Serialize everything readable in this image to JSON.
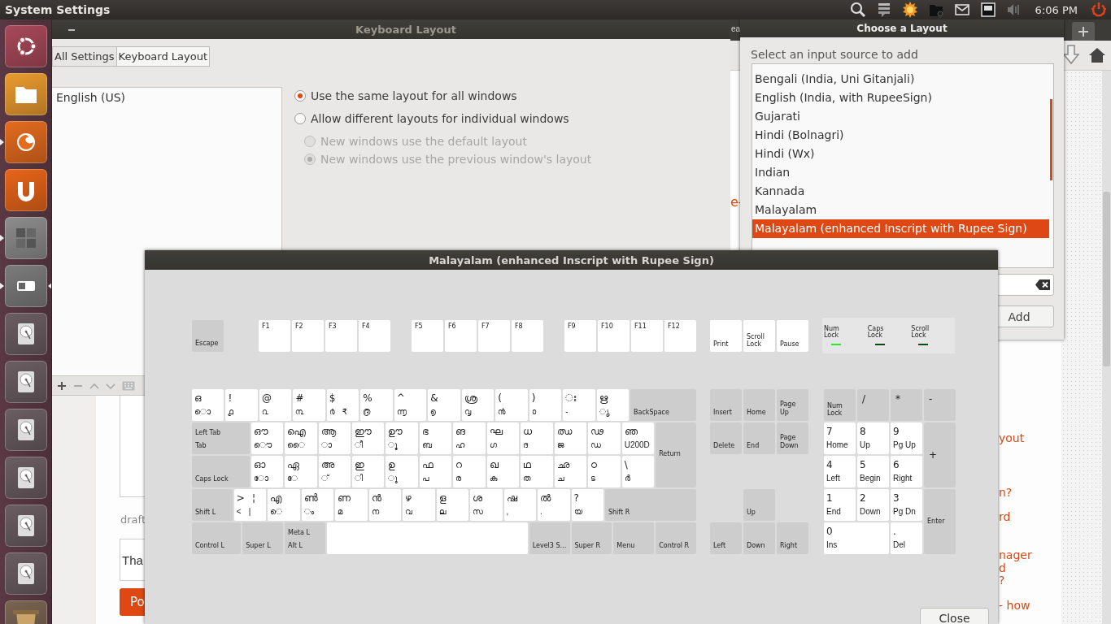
{
  "top_panel": {
    "title": "System Settings",
    "clock": "6:06 PM"
  },
  "launcher": {
    "items": [
      {
        "kind": "dash",
        "running": false,
        "focused": false
      },
      {
        "kind": "files",
        "running": false,
        "focused": false
      },
      {
        "kind": "browser",
        "running": true,
        "focused": false
      },
      {
        "kind": "u_one",
        "running": false,
        "focused": false
      },
      {
        "kind": "workspaces",
        "running": true,
        "focused": false
      },
      {
        "kind": "settings",
        "running": true,
        "focused": true
      },
      {
        "kind": "disk",
        "running": false,
        "focused": false
      },
      {
        "kind": "disk",
        "running": false,
        "focused": false
      },
      {
        "kind": "disk",
        "running": false,
        "focused": false
      },
      {
        "kind": "disk",
        "running": false,
        "focused": false
      },
      {
        "kind": "disk",
        "running": false,
        "focused": false
      },
      {
        "kind": "disk",
        "running": false,
        "focused": false
      },
      {
        "kind": "trash",
        "running": false,
        "focused": false
      }
    ]
  },
  "browser": {
    "tab_fragment": "ea",
    "heading_fragment": "e-",
    "caption": "draft",
    "reply_value": "Tha",
    "post_button": "Po",
    "sidebar_links": [
      "yout",
      "n?",
      "rd",
      "nager",
      "d",
      "?",
      "- how"
    ]
  },
  "keyboard_layout_window": {
    "title": "Keyboard Layout",
    "breadcrumbs": [
      {
        "label": "All Settings",
        "selected": false
      },
      {
        "label": "Keyboard Layout",
        "selected": true
      }
    ],
    "input_sources": [
      {
        "label": "English (US)",
        "selected": false
      }
    ],
    "layout_mode": [
      {
        "label": "Use the same layout for all windows",
        "selected": true,
        "disabled": false
      },
      {
        "label": "Allow different layouts for individual windows",
        "selected": false,
        "disabled": false
      }
    ],
    "new_window_mode": [
      {
        "label": "New windows use the default layout",
        "selected": false,
        "disabled": true
      },
      {
        "label": "New windows use the previous window's layout",
        "selected": true,
        "disabled": true
      }
    ]
  },
  "choose_layout_dialog": {
    "title": "Choose a Layout",
    "prompt": "Select an input source to add",
    "layouts": [
      {
        "label": "Bengali (India, Uni Gitanjali)",
        "selected": false
      },
      {
        "label": "English (India, with RupeeSign)",
        "selected": false
      },
      {
        "label": "Gujarati",
        "selected": false
      },
      {
        "label": "Hindi (Bolnagri)",
        "selected": false
      },
      {
        "label": "Hindi (Wx)",
        "selected": false
      },
      {
        "label": "Indian",
        "selected": false
      },
      {
        "label": "Kannada",
        "selected": false
      },
      {
        "label": "Malayalam",
        "selected": false
      },
      {
        "label": "Malayalam (enhanced Inscript with Rupee Sign)",
        "selected": true
      }
    ],
    "add_button": "Add"
  },
  "keyboard_window": {
    "title": "Malayalam (enhanced Inscript with Rupee Sign)",
    "function_groups": [
      [
        {
          "kind": "func",
          "lines": [
            [
              "Escape"
            ]
          ]
        }
      ],
      [
        {
          "kind": "fkey",
          "lines": [
            [
              "F1"
            ]
          ]
        },
        {
          "kind": "fkey",
          "lines": [
            [
              "F2"
            ]
          ]
        },
        {
          "kind": "fkey",
          "lines": [
            [
              "F3"
            ]
          ]
        },
        {
          "kind": "fkey",
          "lines": [
            [
              "F4"
            ]
          ]
        }
      ],
      [
        {
          "kind": "fkey",
          "lines": [
            [
              "F5"
            ]
          ]
        },
        {
          "kind": "fkey",
          "lines": [
            [
              "F6"
            ]
          ]
        },
        {
          "kind": "fkey",
          "lines": [
            [
              "F7"
            ]
          ]
        },
        {
          "kind": "fkey",
          "lines": [
            [
              "F8"
            ]
          ]
        }
      ],
      [
        {
          "kind": "fkey",
          "lines": [
            [
              "F9"
            ]
          ]
        },
        {
          "kind": "fkey",
          "lines": [
            [
              "F10"
            ]
          ]
        },
        {
          "kind": "fkey",
          "lines": [
            [
              "F11"
            ]
          ]
        },
        {
          "kind": "fkey",
          "lines": [
            [
              "F12"
            ]
          ]
        }
      ]
    ],
    "system_keys": [
      {
        "kind": "sys",
        "lines": [
          [
            "Print"
          ]
        ]
      },
      {
        "kind": "sys",
        "lines": [
          [
            "Scroll Lock"
          ]
        ]
      },
      {
        "kind": "sys",
        "lines": [
          [
            "Pause"
          ]
        ]
      }
    ],
    "indicators": [
      {
        "label": "Num Lock",
        "on": true
      },
      {
        "label": "Caps Lock",
        "on": false
      },
      {
        "label": "Scroll Lock",
        "on": false
      }
    ],
    "main_rows": [
      [
        {
          "kind": "char",
          "lines": [
            [
              "ഒ"
            ],
            [
              "ൊ"
            ]
          ]
        },
        {
          "kind": "char",
          "lines": [
            [
              "!"
            ],
            [
              "൧"
            ]
          ]
        },
        {
          "kind": "char",
          "lines": [
            [
              "@"
            ],
            [
              "൨"
            ]
          ]
        },
        {
          "kind": "char",
          "lines": [
            [
              "#"
            ],
            [
              "൩"
            ]
          ]
        },
        {
          "kind": "char",
          "lines": [
            [
              "$"
            ],
            [
              "൪",
              "₹"
            ]
          ]
        },
        {
          "kind": "char",
          "lines": [
            [
              "%"
            ],
            [
              "൫"
            ]
          ]
        },
        {
          "kind": "char",
          "lines": [
            [
              "^"
            ],
            [
              "൬"
            ]
          ]
        },
        {
          "kind": "char",
          "lines": [
            [
              "&"
            ],
            [
              "൭"
            ]
          ]
        },
        {
          "kind": "char",
          "lines": [
            [
              "ശ്ര"
            ],
            [
              "൮"
            ]
          ]
        },
        {
          "kind": "char",
          "lines": [
            [
              "("
            ],
            [
              "൯"
            ]
          ]
        },
        {
          "kind": "char",
          "lines": [
            [
              ")"
            ],
            [
              "൦"
            ]
          ]
        },
        {
          "kind": "char",
          "lines": [
            [
              "ഃ"
            ],
            [
              "-"
            ]
          ]
        },
        {
          "kind": "char",
          "lines": [
            [
              "ഋ"
            ],
            [
              "ൃ"
            ]
          ]
        },
        {
          "kind": "func",
          "lines": [
            [
              "BackSpace"
            ]
          ]
        }
      ],
      [
        {
          "kind": "func",
          "lines": [
            [
              "Left Tab"
            ],
            [
              "Tab"
            ]
          ]
        },
        {
          "kind": "char",
          "lines": [
            [
              "ഔ"
            ],
            [
              "ൌ"
            ]
          ]
        },
        {
          "kind": "char",
          "lines": [
            [
              "ഐ"
            ],
            [
              "ൈ"
            ]
          ]
        },
        {
          "kind": "char",
          "lines": [
            [
              "ആ"
            ],
            [
              "ാ"
            ]
          ]
        },
        {
          "kind": "char",
          "lines": [
            [
              "ഈ"
            ],
            [
              "ീ"
            ]
          ]
        },
        {
          "kind": "char",
          "lines": [
            [
              "ഊ"
            ],
            [
              "ൂ"
            ]
          ]
        },
        {
          "kind": "char",
          "lines": [
            [
              "ഭ"
            ],
            [
              "ബ"
            ]
          ]
        },
        {
          "kind": "char",
          "lines": [
            [
              "ങ"
            ],
            [
              "ഹ"
            ]
          ]
        },
        {
          "kind": "char",
          "lines": [
            [
              "ഘ"
            ],
            [
              "ഗ"
            ]
          ]
        },
        {
          "kind": "char",
          "lines": [
            [
              "ധ"
            ],
            [
              "ദ"
            ]
          ]
        },
        {
          "kind": "char",
          "lines": [
            [
              "ഝ"
            ],
            [
              "ജ"
            ]
          ]
        },
        {
          "kind": "char",
          "lines": [
            [
              "ഢ"
            ],
            [
              "ഡ"
            ]
          ]
        },
        {
          "kind": "char",
          "lines": [
            [
              "ഞ"
            ],
            [
              "U200D"
            ]
          ]
        },
        {
          "kind": "func",
          "lines": [
            [
              "Return"
            ]
          ]
        }
      ],
      [
        {
          "kind": "func",
          "lines": [
            [
              "Caps Lock"
            ]
          ]
        },
        {
          "kind": "char",
          "lines": [
            [
              "ഓ"
            ],
            [
              "ോ"
            ]
          ]
        },
        {
          "kind": "char",
          "lines": [
            [
              "ഏ"
            ],
            [
              "േ"
            ]
          ]
        },
        {
          "kind": "char",
          "lines": [
            [
              "അ"
            ],
            [
              "്"
            ]
          ]
        },
        {
          "kind": "char",
          "lines": [
            [
              "ഇ"
            ],
            [
              "ി"
            ]
          ]
        },
        {
          "kind": "char",
          "lines": [
            [
              "ഉ"
            ],
            [
              "ു"
            ]
          ]
        },
        {
          "kind": "char",
          "lines": [
            [
              "ഫ"
            ],
            [
              "പ"
            ]
          ]
        },
        {
          "kind": "char",
          "lines": [
            [
              "റ"
            ],
            [
              "ര"
            ]
          ]
        },
        {
          "kind": "char",
          "lines": [
            [
              "ഖ"
            ],
            [
              "ക"
            ]
          ]
        },
        {
          "kind": "char",
          "lines": [
            [
              "ഥ"
            ],
            [
              "ത"
            ]
          ]
        },
        {
          "kind": "char",
          "lines": [
            [
              "ഛ"
            ],
            [
              "ച"
            ]
          ]
        },
        {
          "kind": "char",
          "lines": [
            [
              "ഠ"
            ],
            [
              "ട"
            ]
          ]
        },
        {
          "kind": "char",
          "lines": [
            [
              "\\"
            ],
            [
              "ർ"
            ]
          ]
        }
      ],
      [
        {
          "kind": "func",
          "lines": [
            [
              "Shift L"
            ]
          ]
        },
        {
          "kind": "char",
          "lines": [
            [
              ">",
              "¦"
            ],
            [
              "<",
              "|"
            ]
          ]
        },
        {
          "kind": "char",
          "lines": [
            [
              "എ"
            ],
            [
              "െ"
            ]
          ]
        },
        {
          "kind": "char",
          "lines": [
            [
              "ൺ"
            ],
            [
              "ം"
            ]
          ]
        },
        {
          "kind": "char",
          "lines": [
            [
              "ണ"
            ],
            [
              "മ"
            ]
          ]
        },
        {
          "kind": "char",
          "lines": [
            [
              "ൻ"
            ],
            [
              "ന"
            ]
          ]
        },
        {
          "kind": "char",
          "lines": [
            [
              "ഴ"
            ],
            [
              "വ"
            ]
          ]
        },
        {
          "kind": "char",
          "lines": [
            [
              "ള"
            ],
            [
              "ല"
            ]
          ]
        },
        {
          "kind": "char",
          "lines": [
            [
              "ശ"
            ],
            [
              "സ"
            ]
          ]
        },
        {
          "kind": "char",
          "lines": [
            [
              "ഷ"
            ],
            [
              ","
            ]
          ]
        },
        {
          "kind": "char",
          "lines": [
            [
              "ൽ"
            ],
            [
              "."
            ]
          ]
        },
        {
          "kind": "char",
          "lines": [
            [
              "?"
            ],
            [
              "യ"
            ]
          ]
        },
        {
          "kind": "func",
          "lines": [
            [
              "Shift R"
            ]
          ]
        }
      ],
      [
        {
          "kind": "func",
          "lines": [
            [
              "Control L"
            ]
          ]
        },
        {
          "kind": "func",
          "lines": [
            [
              "Super L"
            ]
          ]
        },
        {
          "kind": "func",
          "lines": [
            [
              "Meta L"
            ],
            [
              "Alt L"
            ]
          ]
        },
        {
          "kind": "space"
        },
        {
          "kind": "func",
          "lines": [
            [
              "Level3 S…"
            ]
          ]
        },
        {
          "kind": "func",
          "lines": [
            [
              "Super R"
            ]
          ]
        },
        {
          "kind": "func",
          "lines": [
            [
              "Menu"
            ]
          ]
        },
        {
          "kind": "func",
          "lines": [
            [
              "Control R"
            ]
          ]
        }
      ]
    ],
    "navigation_keys": [
      {
        "kind": "func",
        "lines": [
          [
            "Insert"
          ]
        ]
      },
      {
        "kind": "func",
        "lines": [
          [
            "Home"
          ]
        ]
      },
      {
        "kind": "func",
        "lines": [
          [
            "Page Up"
          ]
        ]
      },
      {
        "kind": "func",
        "lines": [
          [
            "Delete"
          ]
        ]
      },
      {
        "kind": "func",
        "lines": [
          [
            "End"
          ]
        ]
      },
      {
        "kind": "func",
        "lines": [
          [
            "Page Down"
          ]
        ]
      },
      {
        "kind": "func",
        "lines": [
          [
            "Up"
          ]
        ]
      },
      {
        "kind": "func",
        "lines": [
          [
            "Left"
          ]
        ]
      },
      {
        "kind": "func",
        "lines": [
          [
            "Down"
          ]
        ]
      },
      {
        "kind": "func",
        "lines": [
          [
            "Right"
          ]
        ]
      }
    ],
    "numpad_keys": [
      {
        "kind": "func",
        "lines": [
          [
            "Num Lock"
          ]
        ]
      },
      {
        "kind": "op",
        "lines": [
          [
            "/"
          ]
        ]
      },
      {
        "kind": "op",
        "lines": [
          [
            "*"
          ]
        ]
      },
      {
        "kind": "op",
        "lines": [
          [
            "-"
          ]
        ]
      },
      {
        "kind": "char",
        "lines": [
          [
            "7"
          ],
          [
            "Home"
          ]
        ]
      },
      {
        "kind": "char",
        "lines": [
          [
            "8"
          ],
          [
            "Up"
          ]
        ]
      },
      {
        "kind": "char",
        "lines": [
          [
            "9"
          ],
          [
            "Pg Up"
          ]
        ]
      },
      {
        "kind": "op",
        "lines": [
          [
            "+"
          ]
        ]
      },
      {
        "kind": "char",
        "lines": [
          [
            "4"
          ],
          [
            "Left"
          ]
        ]
      },
      {
        "kind": "char",
        "lines": [
          [
            "5"
          ],
          [
            "Begin"
          ]
        ]
      },
      {
        "kind": "char",
        "lines": [
          [
            "6"
          ],
          [
            "Right"
          ]
        ]
      },
      {
        "kind": "char",
        "lines": [
          [
            "1"
          ],
          [
            "End"
          ]
        ]
      },
      {
        "kind": "char",
        "lines": [
          [
            "2"
          ],
          [
            "Down"
          ]
        ]
      },
      {
        "kind": "char",
        "lines": [
          [
            "3"
          ],
          [
            "Pg Dn"
          ]
        ]
      },
      {
        "kind": "func",
        "lines": [
          [
            "Enter"
          ]
        ]
      },
      {
        "kind": "char",
        "lines": [
          [
            "0"
          ],
          [
            "Ins"
          ]
        ]
      },
      {
        "kind": "char",
        "lines": [
          [
            "."
          ],
          [
            "Del"
          ]
        ]
      }
    ],
    "close_button": "Close"
  }
}
